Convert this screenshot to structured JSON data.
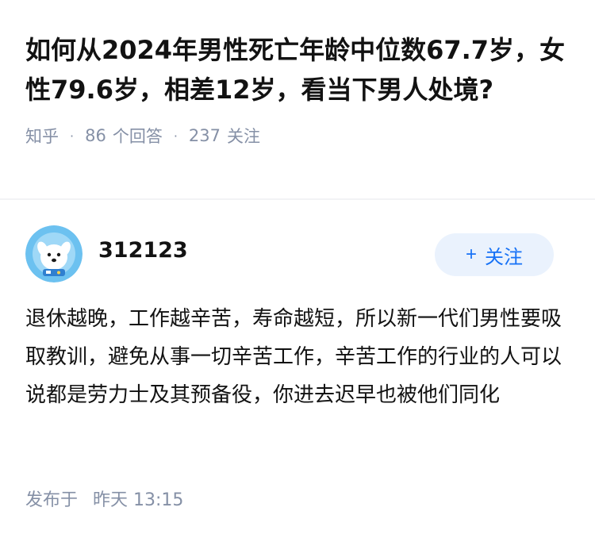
{
  "question": {
    "title": "如何从2024年男性死亡年龄中位数67.7岁，女性79.6岁，相差12岁，看当下男人处境?",
    "source": "知乎",
    "separator": "·",
    "answers_count": "86",
    "answers_label": "个回答",
    "followers_count": "237",
    "followers_label": "关注"
  },
  "answer": {
    "author_name": "312123",
    "follow_plus": "+",
    "follow_label": "关注",
    "content": "退休越晚，工作越辛苦，寿命越短，所以新一代们男性要吸取教训，避免从事一切辛苦工作，辛苦工作的行业的人可以说都是劳力士及其预备役，你进去迟早也被他们同化",
    "published_prefix": "发布于",
    "published_time": "昨天 13:15"
  },
  "icons": {
    "avatar": "cartoon-dog-astronaut-avatar"
  },
  "colors": {
    "accent": "#1772f6",
    "follow_bg": "#eaf2fd",
    "meta_text": "#8590a6",
    "avatar_bg": "#6cc1f0"
  }
}
